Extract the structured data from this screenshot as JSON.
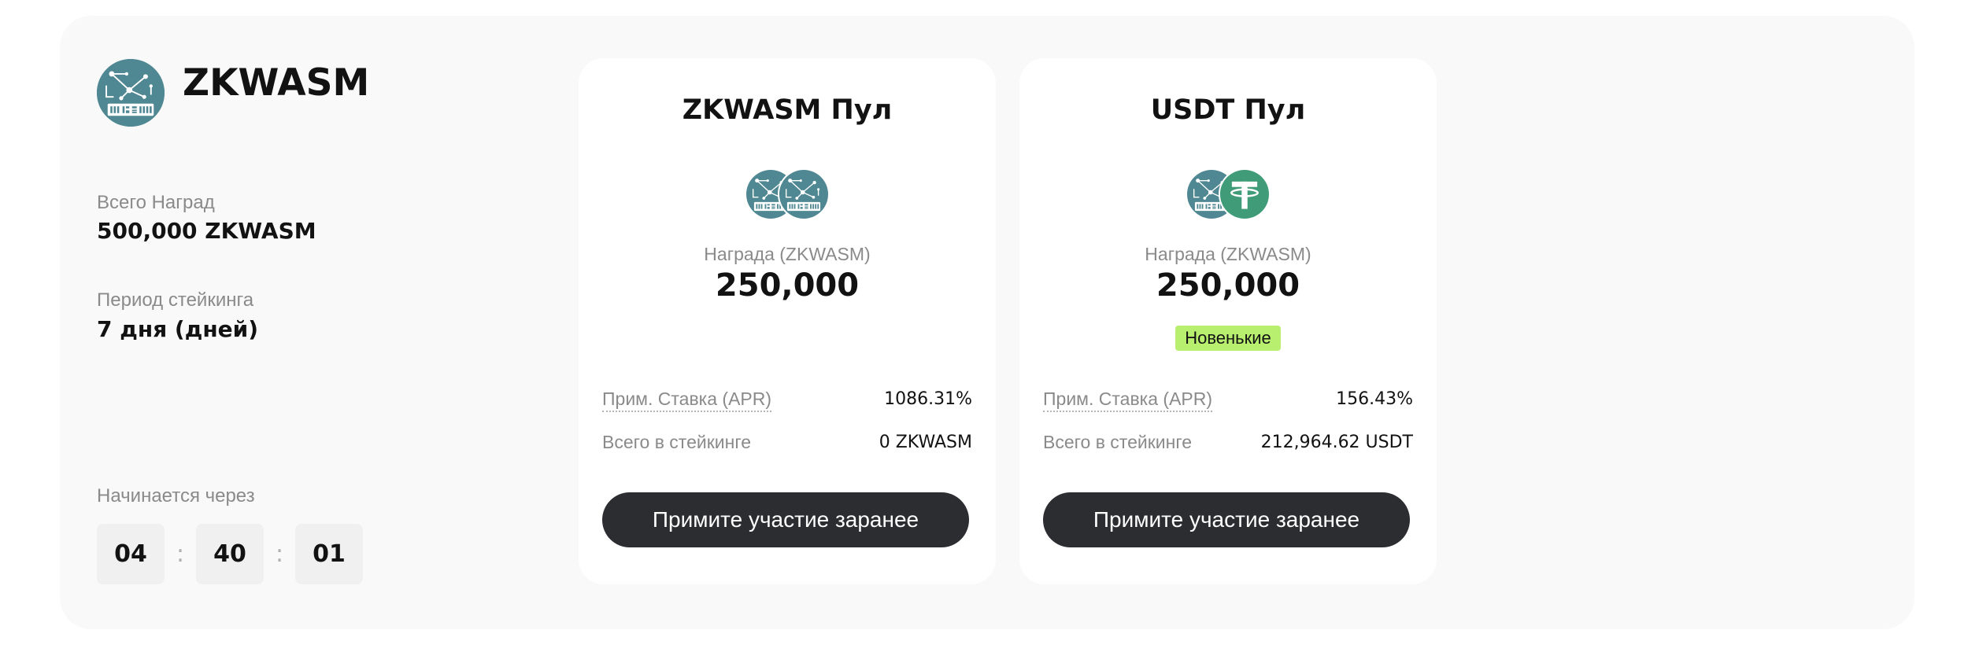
{
  "project": {
    "name": "ZKWASM",
    "logo_icon": "zkwasm-logo-icon",
    "total_rewards_label": "Всего Наград",
    "total_rewards_value": "500,000 ZKWASM",
    "staking_period_label": "Период стейкинга",
    "staking_period_value": "7 дня (дней)",
    "starts_in_label": "Начинается через",
    "countdown": [
      "04",
      "40",
      "01"
    ],
    "countdown_separator": ":"
  },
  "pools": [
    {
      "title": "ZKWASM Пул",
      "icons": [
        "zkwasm-logo-icon",
        "zkwasm-logo-icon"
      ],
      "reward_label": "Награда (ZKWASM)",
      "reward_value": "250,000",
      "apr_label": "Прим. Ставка (APR)",
      "apr_value": "1086.31%",
      "staked_label": "Всего в стейкинге",
      "staked_value": "0 ZKWASM",
      "button_label": "Примите участие заранее"
    },
    {
      "title": "USDT Пул",
      "icons": [
        "zkwasm-logo-icon",
        "tether-logo-icon"
      ],
      "reward_label": "Награда (ZKWASM)",
      "reward_value": "250,000",
      "badge": "Новенькие",
      "apr_label": "Прим. Ставка (APR)",
      "apr_value": "156.43%",
      "staked_label": "Всего в стейкинге",
      "staked_value": "212,964.62 USDT",
      "button_label": "Примите участие заранее"
    }
  ],
  "colors": {
    "panel_background": "#f9f9f9",
    "card_background": "#ffffff",
    "button_background": "#2c2d30",
    "badge_background": "#b8ef6f",
    "zkwasm_brand": "#4f8893",
    "tether_brand": "#409c78"
  }
}
